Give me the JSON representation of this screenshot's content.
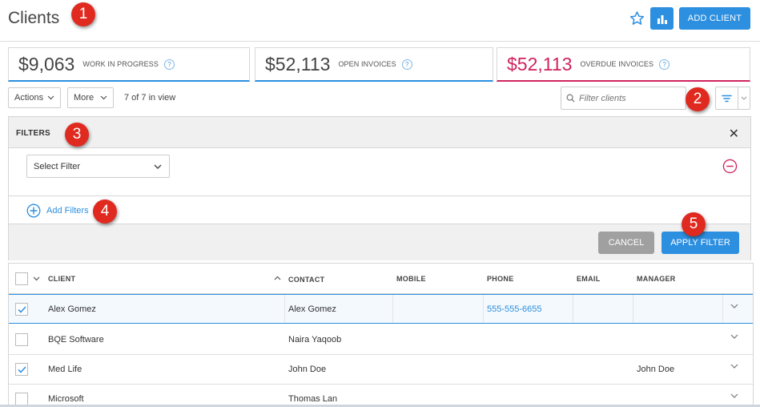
{
  "header": {
    "title": "Clients",
    "add_client_label": "ADD CLIENT",
    "star_icon": "star-outline-icon",
    "chart_icon": "bar-chart-icon"
  },
  "kpis": [
    {
      "value": "$9,063",
      "label": "WORK IN PROGRESS",
      "help": "?"
    },
    {
      "value": "$52,113",
      "label": "OPEN INVOICES",
      "help": "?"
    },
    {
      "value": "$52,113",
      "label": "OVERDUE INVOICES",
      "help": "?"
    }
  ],
  "toolbar": {
    "actions_label": "Actions",
    "more_label": "More",
    "in_view_text": "7 of 7 in view",
    "search_placeholder": "Filter clients"
  },
  "filters_panel": {
    "title": "FILTERS",
    "select_placeholder": "Select Filter",
    "add_filters_label": "Add Filters",
    "cancel_label": "CANCEL",
    "apply_label": "APPLY FILTER"
  },
  "table": {
    "columns": [
      "CLIENT",
      "CONTACT",
      "MOBILE",
      "PHONE",
      "EMAIL",
      "MANAGER"
    ],
    "rows": [
      {
        "checked": true,
        "client": "Alex Gomez",
        "contact": "Alex Gomez",
        "mobile": "",
        "phone": "555-555-6655",
        "email": "",
        "manager": ""
      },
      {
        "checked": false,
        "client": "BQE Software",
        "contact": "Naira Yaqoob",
        "mobile": "",
        "phone": "",
        "email": "",
        "manager": ""
      },
      {
        "checked": true,
        "client": "Med Life",
        "contact": "John Doe",
        "mobile": "",
        "phone": "",
        "email": "",
        "manager": "John Doe"
      },
      {
        "checked": false,
        "client": "Microsoft",
        "contact": "Thomas Lan",
        "mobile": "",
        "phone": "",
        "email": "",
        "manager": ""
      }
    ]
  },
  "callouts": [
    "1",
    "2",
    "3",
    "4",
    "5"
  ],
  "colors": {
    "accent": "#2c8fe0",
    "overdue": "#d0245d",
    "callout": "#e02a1f",
    "cancel": "#a0a0a0"
  }
}
